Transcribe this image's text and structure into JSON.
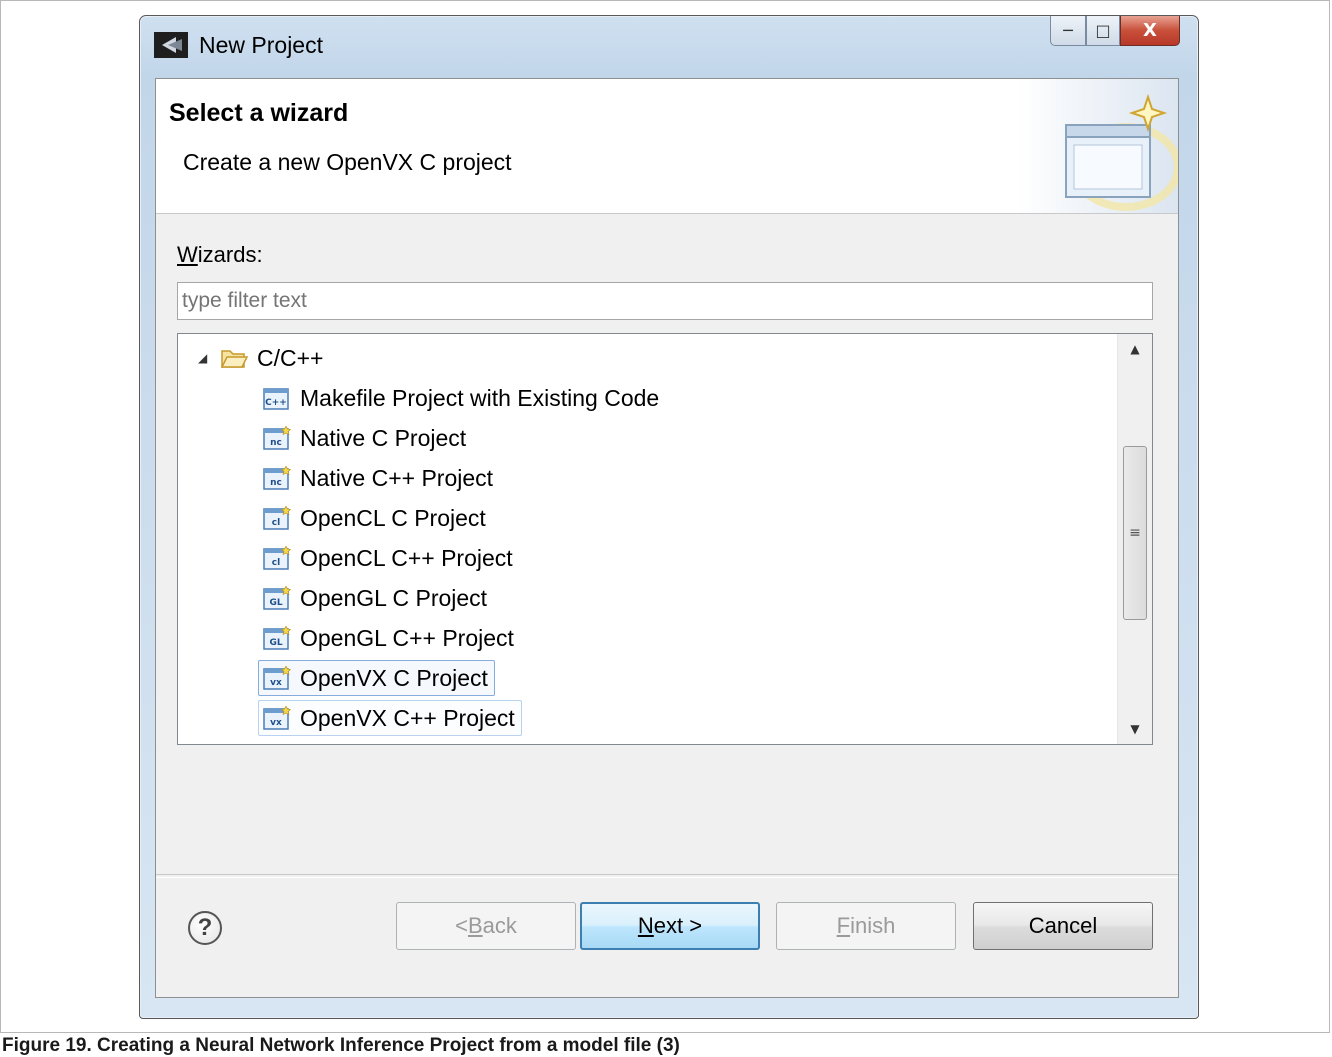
{
  "window": {
    "title": "New Project",
    "controls": {
      "minimize": "─",
      "maximize": "□",
      "close": "X"
    }
  },
  "banner": {
    "title": "Select a wizard",
    "description": "Create a new OpenVX C project"
  },
  "wizards": {
    "label_mnemonic": "W",
    "label_rest": "izards:",
    "filter_placeholder": "type filter text"
  },
  "tree": {
    "category": {
      "label": "C/C++",
      "expanded": true,
      "icon": "folder-open-icon"
    },
    "items": [
      {
        "label": "Makefile Project with Existing Code",
        "icon": "cpp-makefile-project-icon",
        "badge": "C++"
      },
      {
        "label": "Native C Project",
        "icon": "native-c-project-icon",
        "badge": "nc"
      },
      {
        "label": "Native C++ Project",
        "icon": "native-cpp-project-icon",
        "badge": "nc"
      },
      {
        "label": "OpenCL C Project",
        "icon": "opencl-c-project-icon",
        "badge": "cl"
      },
      {
        "label": "OpenCL C++ Project",
        "icon": "opencl-cpp-project-icon",
        "badge": "cl"
      },
      {
        "label": "OpenGL C Project",
        "icon": "opengl-c-project-icon",
        "badge": "GL"
      },
      {
        "label": "OpenGL C++ Project",
        "icon": "opengl-cpp-project-icon",
        "badge": "GL"
      },
      {
        "label": "OpenVX C Project",
        "icon": "openvx-c-project-icon",
        "badge": "vx",
        "selected": true
      },
      {
        "label": "OpenVX C++ Project",
        "icon": "openvx-cpp-project-icon",
        "badge": "vx",
        "hover": true
      }
    ],
    "scrollbar": {
      "thumb_grip": "≡",
      "up": "▲",
      "down": "▼"
    }
  },
  "buttons": {
    "help": "?",
    "back": {
      "pre": "< ",
      "mnemonic": "B",
      "rest": "ack",
      "enabled": false
    },
    "next": {
      "mnemonic": "N",
      "rest": "ext >",
      "enabled": true,
      "default": true
    },
    "finish": {
      "mnemonic": "F",
      "rest": "inish",
      "enabled": false
    },
    "cancel": {
      "label": "Cancel",
      "enabled": true
    }
  },
  "caption": "Figure 19.  Creating a Neural Network Inference Project from a model file (3)",
  "colors": {
    "selection_border": "#84acdd",
    "default_button_border": "#3c7fb1",
    "close_button": "#c8503a"
  }
}
